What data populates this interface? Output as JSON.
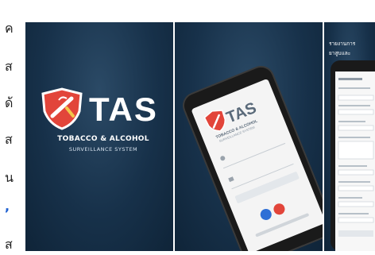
{
  "side_text": {
    "chars": [
      "ค",
      "ส",
      "ด้",
      "ส",
      "น",
      ",",
      "ส"
    ],
    "blue_index": 5
  },
  "screenshots": {
    "shot1": {
      "logo_text": "TAS",
      "subtitle": "TOBACCO & ALCOHOL",
      "subtitle2": "SURVEILLANCE SYSTEM"
    },
    "shot2": {
      "phone_logo_text": "TAS",
      "phone_sub": "TOBACCO & ALCOHOL",
      "phone_sub2": "SURVEILLANCE SYSTEM"
    },
    "shot3": {
      "caption_line1": "รายงานการ",
      "caption_line2": "ยาสูบและ"
    }
  },
  "colors": {
    "bg_dark": "#17314a",
    "logo_red": "#e2453a",
    "logo_white": "#ffffff",
    "link_blue": "#1d5fd0"
  }
}
